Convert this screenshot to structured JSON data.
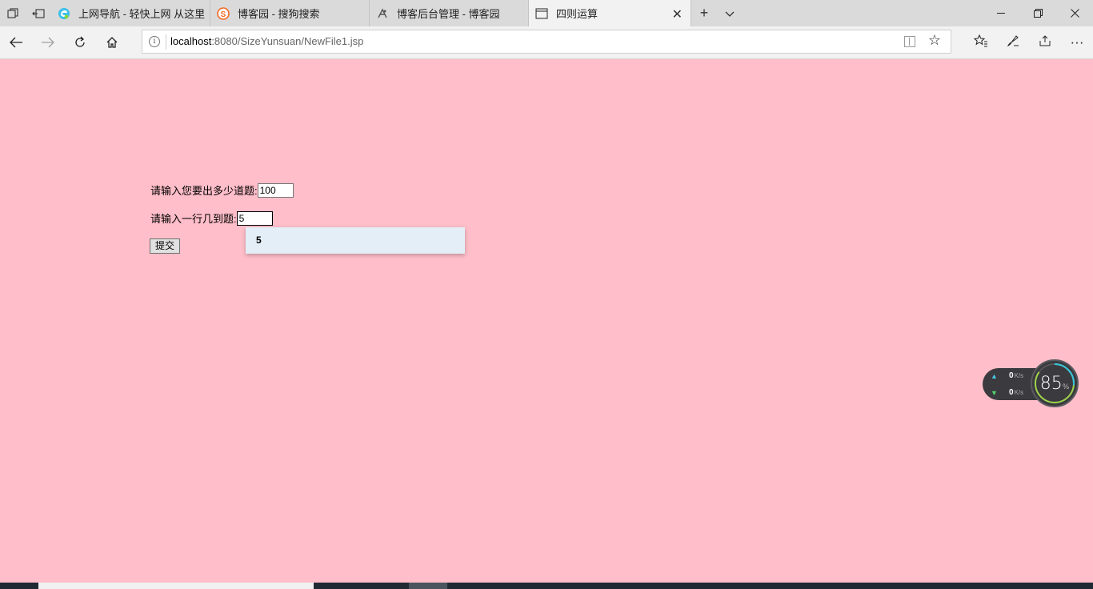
{
  "browser": {
    "tabs": [
      {
        "title": "上网导航 - 轻快上网 从这里",
        "icon": "edge-icon"
      },
      {
        "title": "博客园 - 搜狗搜索",
        "icon": "sogou-icon"
      },
      {
        "title": "博客后台管理 - 博客园",
        "icon": "cnblogs-icon"
      },
      {
        "title": "四则运算",
        "icon": "page-icon",
        "active": true
      }
    ],
    "address": {
      "host": "localhost",
      "path": ":8080/SizeYunsuan/NewFile1.jsp"
    }
  },
  "form": {
    "count_label": "请输入您要出多少道题:",
    "count_value": "100",
    "per_row_label": "请输入一行几到题:",
    "per_row_value": "5",
    "submit_label": "提交",
    "suggestion": "5"
  },
  "net_monitor": {
    "upload_value": "0",
    "upload_unit": "K/s",
    "download_value": "0",
    "download_unit": "K/s",
    "percent": "85",
    "percent_sign": "%"
  },
  "colors": {
    "page_background": "#ffbec9",
    "tabbar": "#dadada",
    "active_tab": "#f2f2f2"
  }
}
